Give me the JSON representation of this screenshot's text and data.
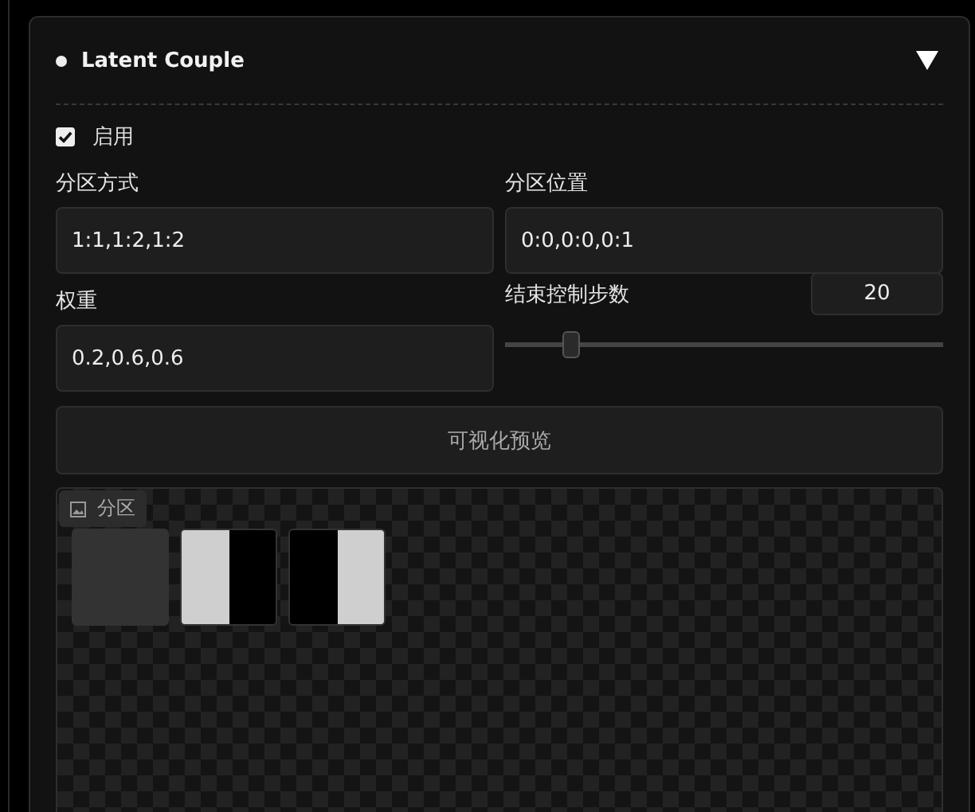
{
  "panel": {
    "title": "Latent Couple",
    "expanded": true
  },
  "enable": {
    "label": "启用",
    "checked": true
  },
  "fields": [
    {
      "label": "分区方式",
      "value": "1:1,1:2,1:2"
    },
    {
      "label": "分区位置",
      "value": "0:0,0:0,0:1"
    },
    {
      "label": "权重",
      "value": "0.2,0.6,0.6"
    }
  ],
  "slider": {
    "label": "结束控制步数",
    "reading": "20",
    "level": 0.15
  },
  "preview_button": "可视化预览",
  "gallery": {
    "badge": "分区",
    "thumbnails": [
      {
        "kind": "empty"
      },
      {
        "kind": "left"
      },
      {
        "kind": "right"
      }
    ]
  }
}
